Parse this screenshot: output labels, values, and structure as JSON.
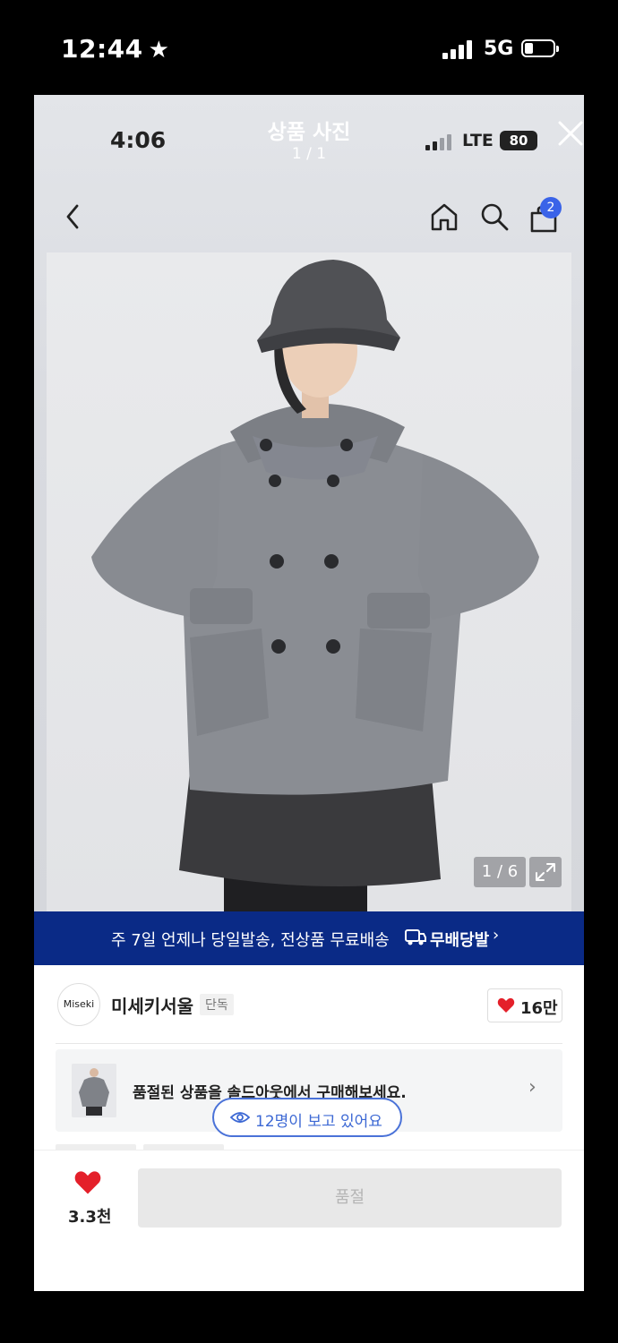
{
  "outer_status": {
    "time": "12:44",
    "network": "5G",
    "star_icon": "★"
  },
  "viewer": {
    "time": "4:06",
    "title": "상품 사진",
    "count": "1 / 1",
    "network": "LTE",
    "battery": "80",
    "cart_badge": "2"
  },
  "gallery": {
    "counter": "1 / 6"
  },
  "promo": {
    "text": "주 7일 언제나 당일발송, 전상품 무료배송",
    "logo_label": "무배당발",
    "chevron": "›"
  },
  "brand": {
    "logo_text": "Miseki",
    "name": "미세키서울",
    "tag": "단독",
    "likes": "16만"
  },
  "soldout_card": {
    "text": "품절된 상품을 솔드아웃에서 구매해보세요.",
    "chevron": "›"
  },
  "viewing": {
    "text": "12명이 보고 있어요"
  },
  "bottom_bar": {
    "wish_count": "3.3천",
    "buy_label": "품절"
  },
  "colors": {
    "banner_bg": "#0a2a86",
    "accent_blue": "#3a63e8",
    "heart_red": "#e4202a",
    "pill_blue": "#4a72d8"
  }
}
